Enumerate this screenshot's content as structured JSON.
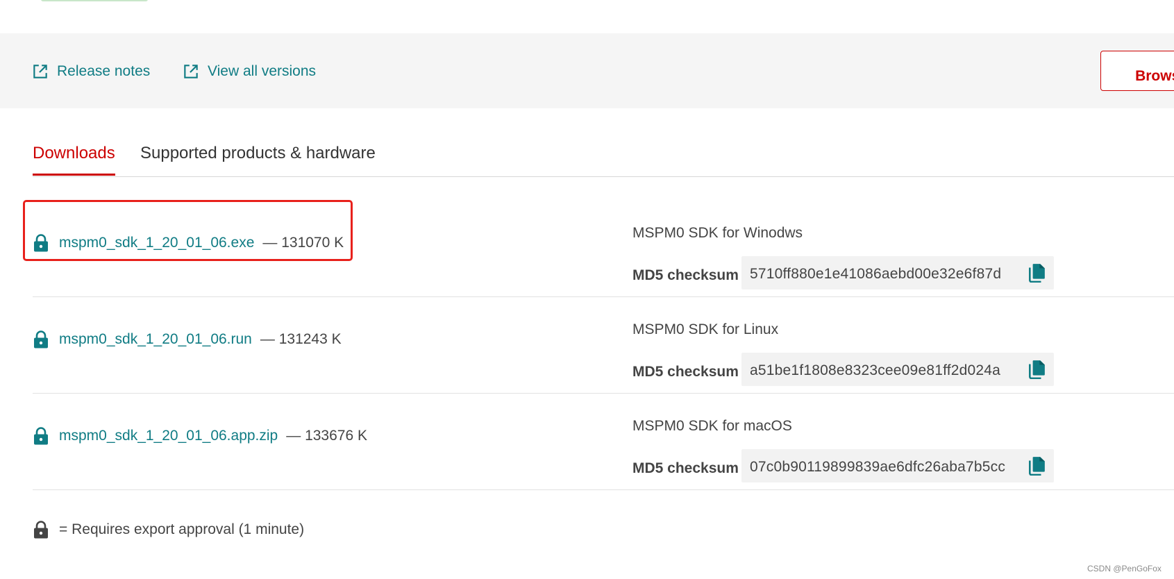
{
  "links": {
    "release_notes": "Release notes",
    "view_all_versions": "View all versions",
    "link_icon": "external-link-icon"
  },
  "browse_button": {
    "label": "Browse"
  },
  "tabs": [
    {
      "label": "Downloads",
      "active": true
    },
    {
      "label": "Supported products & hardware",
      "active": false
    }
  ],
  "downloads": [
    {
      "filename": "mspm0_sdk_1_20_01_06.exe",
      "size": "— 131070 K",
      "description": "MSPM0 SDK for Winodws",
      "md5_label": "MD5 checksum",
      "md5": "5710ff880e1e41086aebd00e32e6f87d"
    },
    {
      "filename": "mspm0_sdk_1_20_01_06.run",
      "size": "— 131243 K",
      "description": "MSPM0 SDK for Linux",
      "md5_label": "MD5 checksum",
      "md5": "a51be1f1808e8323cee09e81ff2d024a"
    },
    {
      "filename": "mspm0_sdk_1_20_01_06.app.zip",
      "size": "— 133676 K",
      "description": "MSPM0 SDK for macOS",
      "md5_label": "MD5 checksum",
      "md5": "07c0b90119899839ae6dfc26aba7b5cc"
    }
  ],
  "icons": {
    "lock": "lock-icon",
    "copy": "copy-icon"
  },
  "footnote": "= Requires export approval (1 minute)",
  "watermark": "CSDN @PenGoFox",
  "colors": {
    "link": "#107c84",
    "accent_red": "#cc0000",
    "highlight_red": "#e8211c",
    "bar_background": "#f5f5f5"
  }
}
